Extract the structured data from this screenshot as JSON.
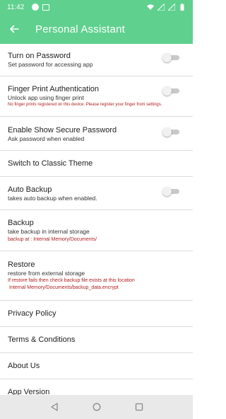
{
  "status_bar": {
    "time": "11:42"
  },
  "app_bar": {
    "title": "Personal Assistant"
  },
  "settings": {
    "turn_on_password": {
      "title": "Turn on Password",
      "subtitle": "Set password for accessing app",
      "enabled": false
    },
    "finger_print": {
      "title": "Finger Print Authentication",
      "subtitle": "Unlock app using finger print",
      "warning": "No finger prints registered on this device. Please register your finger from settings.",
      "enabled": false
    },
    "show_secure_password": {
      "title": "Enable Show Secure Password",
      "subtitle": "Ask password when enabled",
      "enabled": false
    },
    "classic_theme": {
      "title": "Switch to Classic Theme"
    },
    "auto_backup": {
      "title": "Auto Backup",
      "subtitle": "takes auto backup when enabled.",
      "enabled": false
    },
    "backup": {
      "title": "Backup",
      "subtitle": "take backup in internal storage",
      "note": "backup at : Internal Memory/Documents/"
    },
    "restore": {
      "title": "Restore",
      "subtitle": "restore from external storage",
      "note_line1": "If restore fails then check backup file exists at this location",
      "note_line2": "Internal Memory/Documents/backup_data.encrypt"
    },
    "privacy_policy": {
      "title": "Privacy Policy"
    },
    "terms": {
      "title": "Terms & Conditions"
    },
    "about_us": {
      "title": "About Us"
    },
    "app_version": {
      "title": "App Version"
    }
  },
  "colors": {
    "accent": "#5fd08e",
    "warning_text": "#b02020"
  }
}
